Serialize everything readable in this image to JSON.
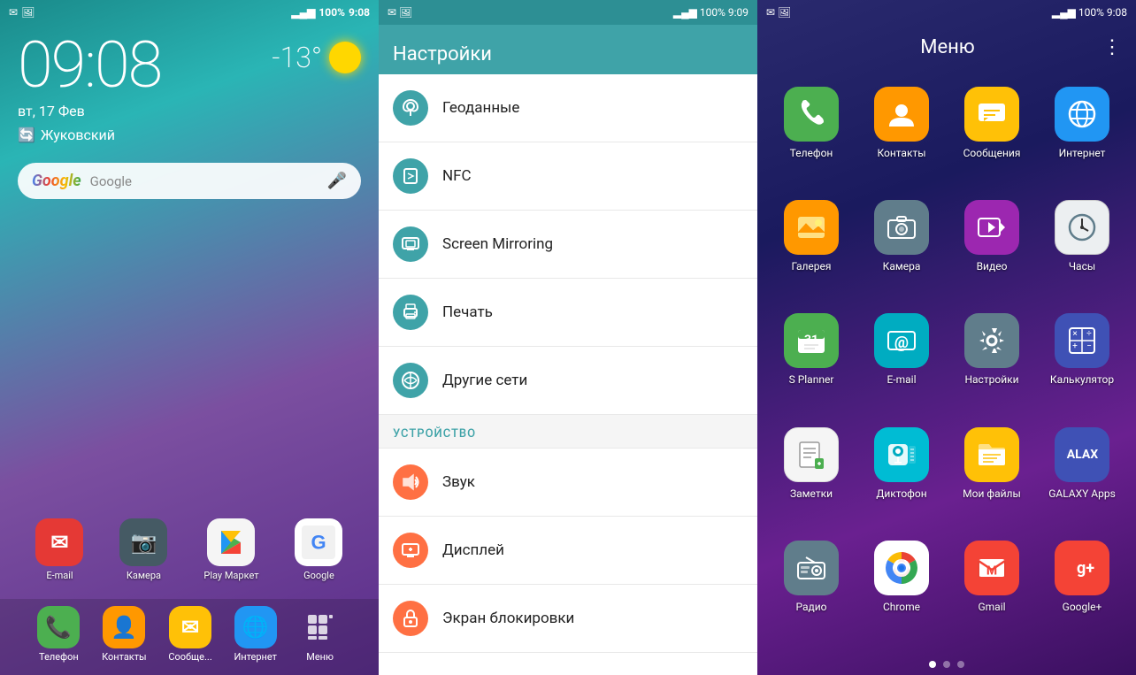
{
  "panel1": {
    "status_bar": {
      "time": "9:08",
      "battery": "100%",
      "signal": "▂▄▆"
    },
    "clock": "09:08",
    "date": "вт, 17 Фев",
    "temp": "-13°",
    "location": "Жуковский",
    "search_placeholder": "Google",
    "dock": [
      {
        "label": "Телефон",
        "icon": "phone",
        "color": "#4CAF50"
      },
      {
        "label": "Контакты",
        "icon": "contacts",
        "color": "#FF9800"
      },
      {
        "label": "Сообще...",
        "icon": "messages",
        "color": "#FFC107"
      },
      {
        "label": "Интернет",
        "icon": "browser",
        "color": "#2196F3"
      },
      {
        "label": "Меню",
        "icon": "grid",
        "color": "#888"
      }
    ]
  },
  "panel2": {
    "status_bar": {
      "time": "9:09",
      "battery": "100%"
    },
    "title": "Настройки",
    "items": [
      {
        "icon": "📍",
        "label": "Геоданные",
        "color": "#3fa3a8"
      },
      {
        "icon": "📶",
        "label": "NFC",
        "color": "#3fa3a8"
      },
      {
        "icon": "📺",
        "label": "Screen Mirroring",
        "color": "#3fa3a8"
      },
      {
        "icon": "🖨",
        "label": "Печать",
        "color": "#3fa3a8"
      },
      {
        "icon": "📡",
        "label": "Другие сети",
        "color": "#3fa3a8"
      }
    ],
    "section_device": "УСТРОЙСТВО",
    "device_items": [
      {
        "icon": "🔊",
        "label": "Звук",
        "color": "#FF7043"
      },
      {
        "icon": "🖥",
        "label": "Дисплей",
        "color": "#FF7043"
      },
      {
        "icon": "🔒",
        "label": "Экран блокировки",
        "color": "#FF7043"
      }
    ]
  },
  "panel3": {
    "status_bar": {
      "time": "9:08",
      "battery": "100%"
    },
    "title": "Меню",
    "apps": [
      {
        "label": "Телефон",
        "color": "#4CAF50",
        "emoji": "📞"
      },
      {
        "label": "Контакты",
        "color": "#FF9800",
        "emoji": "👤"
      },
      {
        "label": "Сообщения",
        "color": "#FFC107",
        "emoji": "✉"
      },
      {
        "label": "Интернет",
        "color": "#2196F3",
        "emoji": "🌐"
      },
      {
        "label": "Галерея",
        "color": "#FF9800",
        "emoji": "🖼"
      },
      {
        "label": "Камера",
        "color": "#607D8B",
        "emoji": "📷"
      },
      {
        "label": "Видео",
        "color": "#9C27B0",
        "emoji": "▶"
      },
      {
        "label": "Часы",
        "color": "#F5F5F5",
        "emoji": "🕐"
      },
      {
        "label": "S Planner",
        "color": "#4CAF50",
        "emoji": "31"
      },
      {
        "label": "E-mail",
        "color": "#00ACC1",
        "emoji": "@"
      },
      {
        "label": "Настройки",
        "color": "#607D8B",
        "emoji": "⚙"
      },
      {
        "label": "Калькулятор",
        "color": "#3F51B5",
        "emoji": "✕÷"
      },
      {
        "label": "Заметки",
        "color": "#F5F5F5",
        "emoji": "📝"
      },
      {
        "label": "Диктофон",
        "color": "#00BCD4",
        "emoji": "🎤"
      },
      {
        "label": "Мои файлы",
        "color": "#FFC107",
        "emoji": "📁"
      },
      {
        "label": "GALAXY Apps",
        "color": "#3F51B5",
        "emoji": "G"
      },
      {
        "label": "Радио",
        "color": "#607D8B",
        "emoji": "📻"
      },
      {
        "label": "Chrome",
        "color": "#F5F5F5",
        "emoji": "C"
      },
      {
        "label": "Gmail",
        "color": "#F44336",
        "emoji": "M"
      },
      {
        "label": "Google+",
        "color": "#F44336",
        "emoji": "g+"
      }
    ],
    "dots": [
      true,
      false,
      false
    ]
  }
}
